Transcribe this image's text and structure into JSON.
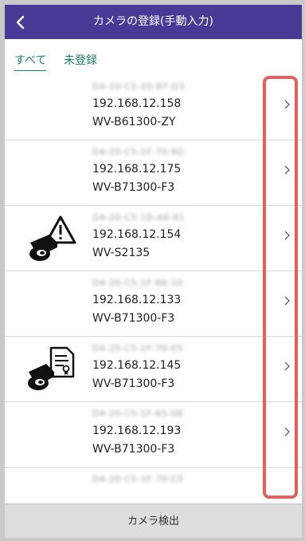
{
  "header": {
    "title": "カメラの登録(手動入力)"
  },
  "tabs": [
    {
      "label": "すべて",
      "selected": true
    },
    {
      "label": "未登録",
      "selected": false
    }
  ],
  "devices": [
    {
      "mac": "D4-20-C5-20-87-D3",
      "ip": "192.168.12.158",
      "model": "WV-B61300-ZY",
      "icon": ""
    },
    {
      "mac": "D4-20-C5-1F-70-9D",
      "ip": "192.168.12.175",
      "model": "WV-B71300-F3",
      "icon": ""
    },
    {
      "mac": "D4-20-C5-1D-A6-61",
      "ip": "192.168.12.154",
      "model": "WV-S2135",
      "icon": "camera-warning-icon"
    },
    {
      "mac": "D4-20-C5-1F-66-10",
      "ip": "192.168.12.133",
      "model": "WV-B71300-F3",
      "icon": ""
    },
    {
      "mac": "D4-20-C5-1F-70-E5",
      "ip": "192.168.12.145",
      "model": "WV-B71300-F3",
      "icon": "camera-certificate-icon"
    },
    {
      "mac": "D4-20-C5-1F-65-DE",
      "ip": "192.168.12.193",
      "model": "WV-B71300-F3",
      "icon": ""
    },
    {
      "mac": "D4-20-C5-1F-70-C0",
      "ip": "",
      "model": "",
      "icon": ""
    }
  ],
  "footer": {
    "detect_label": "カメラ検出"
  },
  "colors": {
    "header_bg": "#4a3a98",
    "tab_text": "#1a7f65",
    "highlight": "#e4605d",
    "footer_bg": "#dddddd"
  }
}
